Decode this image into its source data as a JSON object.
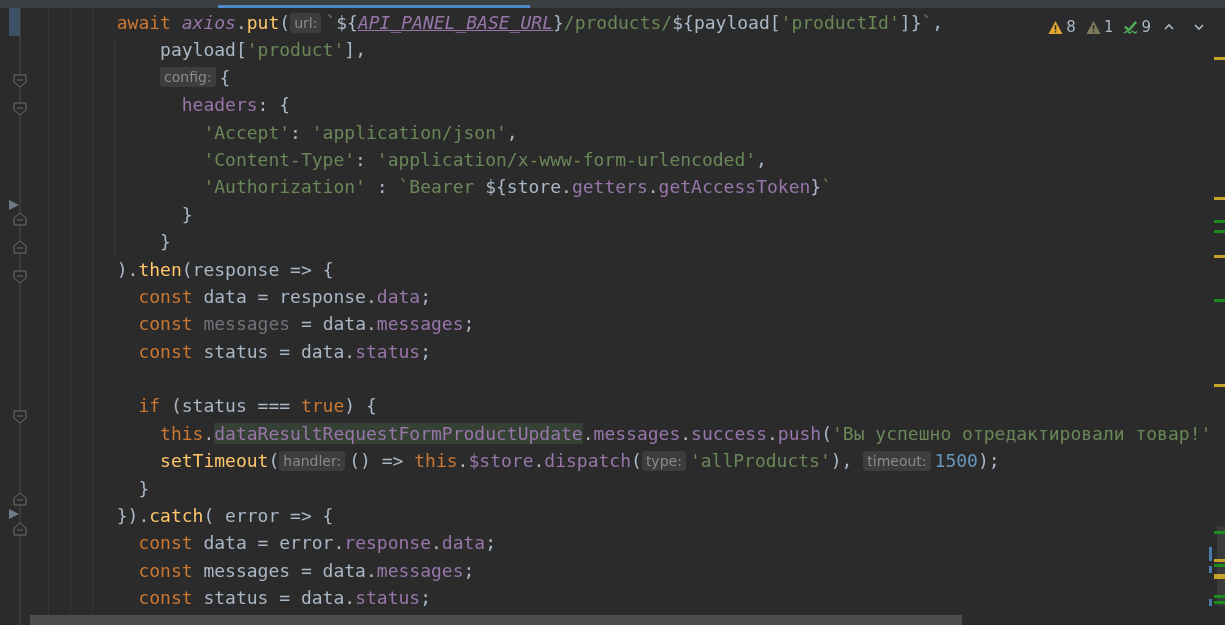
{
  "inspections": [
    {
      "kind": "warning",
      "count": "8"
    },
    {
      "kind": "weak_warning",
      "count": "1"
    },
    {
      "kind": "typo",
      "count": "9"
    }
  ],
  "code_lines": [
    {
      "tokens": [
        {
          "kind": "keyword",
          "text": "        await "
        },
        {
          "kind": "static",
          "text": "axios"
        },
        {
          "kind": "plain",
          "text": "."
        },
        {
          "kind": "function",
          "text": "put"
        },
        {
          "kind": "plain",
          "text": "("
        },
        {
          "kind": "hint",
          "text": "url:"
        },
        {
          "kind": "string",
          "text": "`"
        },
        {
          "kind": "plain",
          "text": "${"
        },
        {
          "kind": "constant",
          "text": "API_PANEL_BASE_URL"
        },
        {
          "kind": "plain",
          "text": "}"
        },
        {
          "kind": "string",
          "text": "/products/"
        },
        {
          "kind": "plain",
          "text": "${payload["
        },
        {
          "kind": "string",
          "text": "'productId'"
        },
        {
          "kind": "plain",
          "text": "]}"
        },
        {
          "kind": "string",
          "text": "`"
        },
        {
          "kind": "plain",
          "text": ","
        }
      ]
    },
    {
      "tokens": [
        {
          "kind": "plain",
          "text": "            payload["
        },
        {
          "kind": "string",
          "text": "'product'"
        },
        {
          "kind": "plain",
          "text": "],"
        }
      ]
    },
    {
      "tokens": [
        {
          "kind": "hint",
          "text": "            config:"
        },
        {
          "kind": "plain",
          "text": "{"
        }
      ]
    },
    {
      "tokens": [
        {
          "kind": "property",
          "text": "              headers"
        },
        {
          "kind": "plain",
          "text": ": {"
        }
      ]
    },
    {
      "tokens": [
        {
          "kind": "string",
          "text": "                'Accept'"
        },
        {
          "kind": "plain",
          "text": ": "
        },
        {
          "kind": "string",
          "text": "'application/json'"
        },
        {
          "kind": "plain",
          "text": ","
        }
      ]
    },
    {
      "tokens": [
        {
          "kind": "string",
          "text": "                'Content-Type'"
        },
        {
          "kind": "plain",
          "text": ": "
        },
        {
          "kind": "string",
          "text": "'application/x-www-form-urlencoded'"
        },
        {
          "kind": "plain",
          "text": ","
        }
      ]
    },
    {
      "tokens": [
        {
          "kind": "string",
          "text": "                'Authorization'"
        },
        {
          "kind": "plain",
          "text": " : "
        },
        {
          "kind": "string",
          "text": "`Bearer "
        },
        {
          "kind": "plain",
          "text": "${store."
        },
        {
          "kind": "property",
          "text": "getters"
        },
        {
          "kind": "plain",
          "text": "."
        },
        {
          "kind": "property",
          "text": "getAccessToken"
        },
        {
          "kind": "plain",
          "text": "}"
        },
        {
          "kind": "string",
          "text": "`"
        }
      ]
    },
    {
      "tokens": [
        {
          "kind": "plain",
          "text": "              }"
        }
      ]
    },
    {
      "tokens": [
        {
          "kind": "plain",
          "text": "            }"
        }
      ]
    },
    {
      "tokens": [
        {
          "kind": "plain",
          "text": "        )."
        },
        {
          "kind": "function",
          "text": "then"
        },
        {
          "kind": "plain",
          "text": "(response => {"
        }
      ]
    },
    {
      "tokens": [
        {
          "kind": "keyword",
          "text": "          const "
        },
        {
          "kind": "plain",
          "text": "data = response."
        },
        {
          "kind": "property",
          "text": "data"
        },
        {
          "kind": "plain",
          "text": ";"
        }
      ]
    },
    {
      "tokens": [
        {
          "kind": "keyword",
          "text": "          const "
        },
        {
          "kind": "unused",
          "text": "messages"
        },
        {
          "kind": "plain",
          "text": " = data."
        },
        {
          "kind": "property",
          "text": "messages"
        },
        {
          "kind": "plain",
          "text": ";"
        }
      ]
    },
    {
      "tokens": [
        {
          "kind": "keyword",
          "text": "          const "
        },
        {
          "kind": "plain",
          "text": "status = data."
        },
        {
          "kind": "property",
          "text": "status"
        },
        {
          "kind": "plain",
          "text": ";"
        }
      ]
    },
    {
      "blank": true
    },
    {
      "tokens": [
        {
          "kind": "keyword",
          "text": "          if "
        },
        {
          "kind": "plain",
          "text": "(status === "
        },
        {
          "kind": "keyword",
          "text": "true"
        },
        {
          "kind": "plain",
          "text": ") {"
        }
      ]
    },
    {
      "tokens": [
        {
          "kind": "keyword",
          "text": "            this"
        },
        {
          "kind": "plain",
          "text": "."
        },
        {
          "kind": "highlight",
          "text": "dataResultRequestFormProductUpdate"
        },
        {
          "kind": "plain",
          "text": "."
        },
        {
          "kind": "property",
          "text": "messages"
        },
        {
          "kind": "plain",
          "text": "."
        },
        {
          "kind": "property",
          "text": "success"
        },
        {
          "kind": "plain",
          "text": "."
        },
        {
          "kind": "property",
          "text": "push"
        },
        {
          "kind": "plain",
          "text": "("
        },
        {
          "kind": "string",
          "text": "'Вы успешно отредактировали товар!'"
        }
      ]
    },
    {
      "tokens": [
        {
          "kind": "function",
          "text": "            setTimeout"
        },
        {
          "kind": "plain",
          "text": "("
        },
        {
          "kind": "hint",
          "text": "handler:"
        },
        {
          "kind": "plain",
          "text": "() => "
        },
        {
          "kind": "keyword",
          "text": "this"
        },
        {
          "kind": "plain",
          "text": "."
        },
        {
          "kind": "property",
          "text": "$store"
        },
        {
          "kind": "plain",
          "text": "."
        },
        {
          "kind": "property",
          "text": "dispatch"
        },
        {
          "kind": "plain",
          "text": "("
        },
        {
          "kind": "hint",
          "text": "type:"
        },
        {
          "kind": "string",
          "text": "'allProducts'"
        },
        {
          "kind": "plain",
          "text": "), "
        },
        {
          "kind": "hint",
          "text": "timeout:"
        },
        {
          "kind": "number",
          "text": "1500"
        },
        {
          "kind": "plain",
          "text": ");"
        }
      ]
    },
    {
      "tokens": [
        {
          "kind": "plain",
          "text": "          }"
        }
      ]
    },
    {
      "tokens": [
        {
          "kind": "plain",
          "text": "        })."
        },
        {
          "kind": "function",
          "text": "catch"
        },
        {
          "kind": "plain",
          "text": "( error => {"
        }
      ]
    },
    {
      "tokens": [
        {
          "kind": "keyword",
          "text": "          const "
        },
        {
          "kind": "plain",
          "text": "data = error."
        },
        {
          "kind": "property",
          "text": "response"
        },
        {
          "kind": "plain",
          "text": "."
        },
        {
          "kind": "property",
          "text": "data"
        },
        {
          "kind": "plain",
          "text": ";"
        }
      ]
    },
    {
      "tokens": [
        {
          "kind": "keyword",
          "text": "          const "
        },
        {
          "kind": "plain",
          "text": "messages = data."
        },
        {
          "kind": "property",
          "text": "messages"
        },
        {
          "kind": "plain",
          "text": ";"
        }
      ]
    },
    {
      "tokens": [
        {
          "kind": "keyword",
          "text": "          const "
        },
        {
          "kind": "plain",
          "text": "status = data."
        },
        {
          "kind": "property",
          "text": "status"
        },
        {
          "kind": "plain",
          "text": ";"
        }
      ]
    }
  ]
}
